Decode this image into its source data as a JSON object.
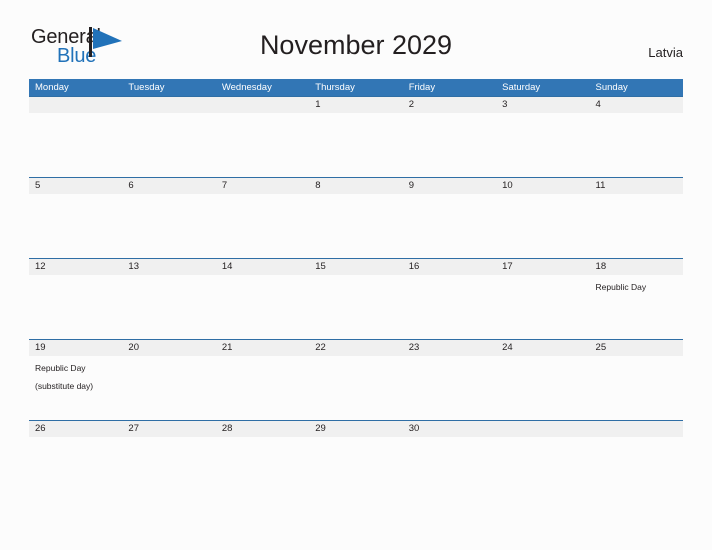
{
  "brand": {
    "name_part1": "General",
    "name_part2": "Blue",
    "flag_icon": "flag-triangle-icon",
    "dark_color": "#231f20",
    "blue_color": "#2172b9"
  },
  "header": {
    "title": "November 2029",
    "country": "Latvia"
  },
  "theme": {
    "header_blue": "#3276b5",
    "rule_blue": "#2f6ea5",
    "band_gray": "#f0f0f0",
    "page_background": "#fcfcfc",
    "text_color": "#231f20"
  },
  "calendar": {
    "weekdays": [
      "Monday",
      "Tuesday",
      "Wednesday",
      "Thursday",
      "Friday",
      "Saturday",
      "Sunday"
    ],
    "weeks": [
      [
        {
          "date": "",
          "events": ""
        },
        {
          "date": "",
          "events": ""
        },
        {
          "date": "",
          "events": ""
        },
        {
          "date": "1",
          "events": ""
        },
        {
          "date": "2",
          "events": ""
        },
        {
          "date": "3",
          "events": ""
        },
        {
          "date": "4",
          "events": ""
        }
      ],
      [
        {
          "date": "5",
          "events": ""
        },
        {
          "date": "6",
          "events": ""
        },
        {
          "date": "7",
          "events": ""
        },
        {
          "date": "8",
          "events": ""
        },
        {
          "date": "9",
          "events": ""
        },
        {
          "date": "10",
          "events": ""
        },
        {
          "date": "11",
          "events": ""
        }
      ],
      [
        {
          "date": "12",
          "events": ""
        },
        {
          "date": "13",
          "events": ""
        },
        {
          "date": "14",
          "events": ""
        },
        {
          "date": "15",
          "events": ""
        },
        {
          "date": "16",
          "events": ""
        },
        {
          "date": "17",
          "events": ""
        },
        {
          "date": "18",
          "events": "Republic Day"
        }
      ],
      [
        {
          "date": "19",
          "events": "Republic Day\n(substitute day)"
        },
        {
          "date": "20",
          "events": ""
        },
        {
          "date": "21",
          "events": ""
        },
        {
          "date": "22",
          "events": ""
        },
        {
          "date": "23",
          "events": ""
        },
        {
          "date": "24",
          "events": ""
        },
        {
          "date": "25",
          "events": ""
        }
      ],
      [
        {
          "date": "26",
          "events": ""
        },
        {
          "date": "27",
          "events": ""
        },
        {
          "date": "28",
          "events": ""
        },
        {
          "date": "29",
          "events": ""
        },
        {
          "date": "30",
          "events": ""
        },
        {
          "date": "",
          "events": ""
        },
        {
          "date": "",
          "events": ""
        }
      ]
    ]
  }
}
